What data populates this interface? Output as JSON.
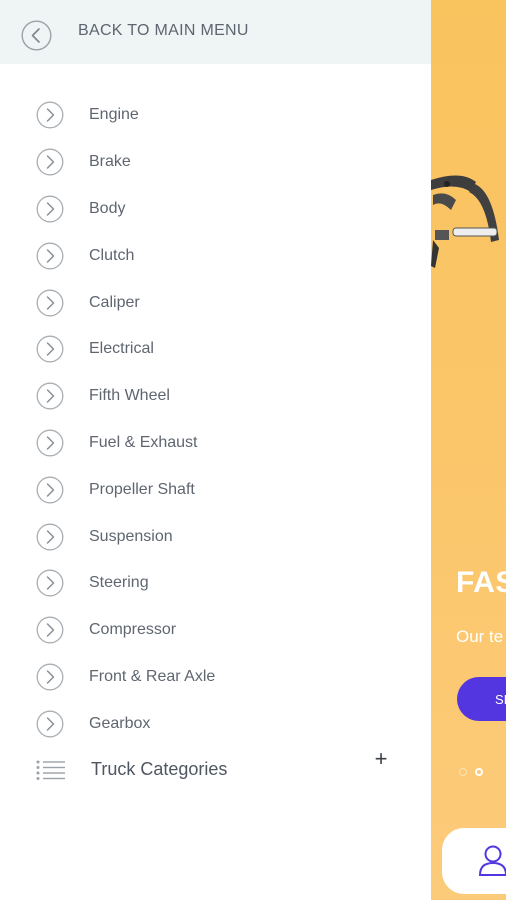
{
  "drawer": {
    "back_label": "BACK TO MAIN MENU",
    "items": [
      {
        "label": "Engine"
      },
      {
        "label": "Brake"
      },
      {
        "label": "Body"
      },
      {
        "label": "Clutch"
      },
      {
        "label": "Caliper"
      },
      {
        "label": "Electrical"
      },
      {
        "label": "Fifth Wheel"
      },
      {
        "label": "Fuel & Exhaust"
      },
      {
        "label": "Propeller Shaft"
      },
      {
        "label": "Suspension"
      },
      {
        "label": "Steering"
      },
      {
        "label": "Compressor"
      },
      {
        "label": "Front & Rear Axle"
      },
      {
        "label": "Gearbox"
      }
    ],
    "categories_label": "Truck Categories",
    "expand_symbol": "+"
  },
  "background": {
    "title": "FAS",
    "subtitle": "Our te",
    "button_label": "SI",
    "accent_color": "#5436e0",
    "banner_color": "#fbc66a"
  }
}
